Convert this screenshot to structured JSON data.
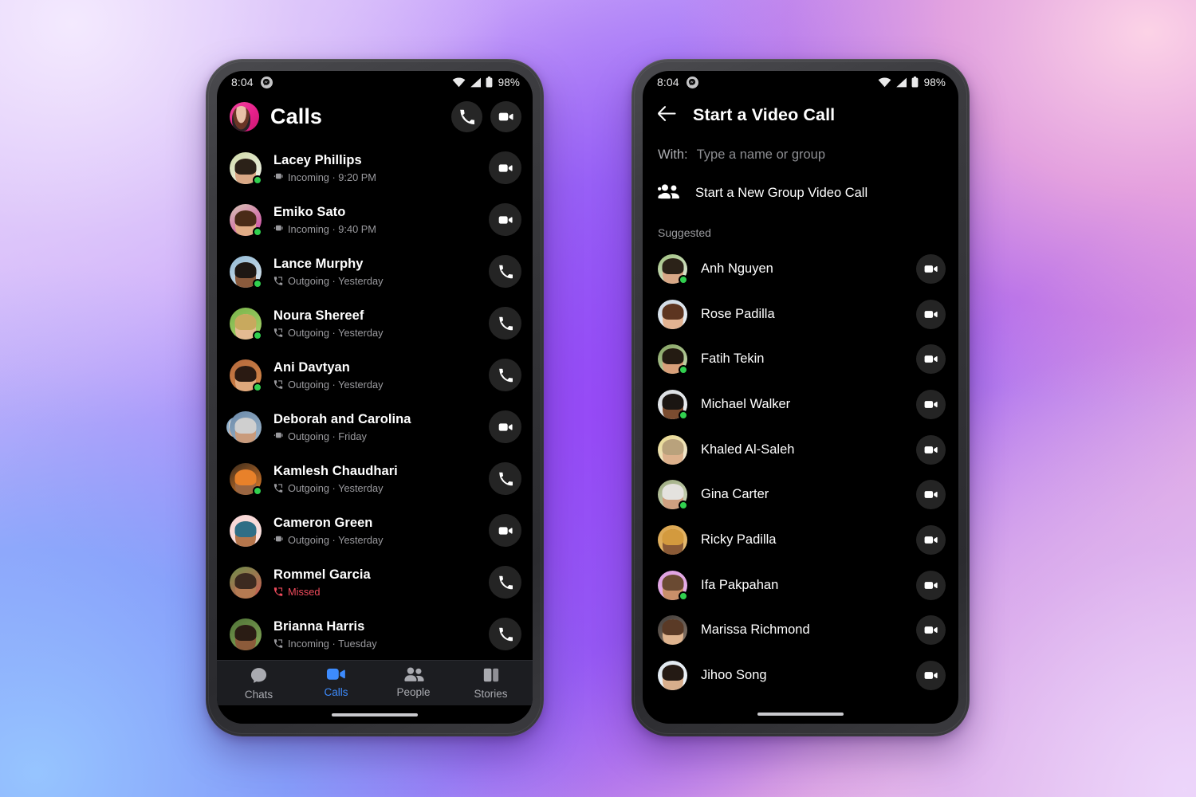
{
  "background": {
    "accent_purple": "#9648f6",
    "accent_pink": "#f68ccd",
    "accent_blue": "#7ab0fc"
  },
  "status_bar": {
    "time": "8:04",
    "battery": "98%",
    "messenger_icon": "messenger-icon",
    "wifi_icon": "wifi-icon",
    "signal_icon": "signal-icon",
    "battery_icon": "battery-icon"
  },
  "left_phone": {
    "header": {
      "title": "Calls",
      "avatar_name": "profile-avatar",
      "audio_call_button": "audio-call-icon",
      "video_call_button": "video-call-icon"
    },
    "calls": [
      {
        "name": "Lacey Phillips",
        "direction": "Incoming",
        "time": "9:20 PM",
        "sub": "Incoming · 9:20 PM",
        "type": "video",
        "action": "video",
        "online": true,
        "missed": false,
        "group": false,
        "c1": "#cfd9a6",
        "c2": "#f2f4ee",
        "hair": "#2b2118",
        "skin": "#d9a886"
      },
      {
        "name": "Emiko Sato",
        "direction": "Incoming",
        "time": "9:40 PM",
        "sub": "Incoming · 9:40 PM",
        "type": "video",
        "action": "video",
        "online": true,
        "missed": false,
        "group": false,
        "c1": "#d8c7b4",
        "c2": "#cf3fa5",
        "hair": "#4a2b18",
        "skin": "#e0ab85"
      },
      {
        "name": "Lance Murphy",
        "direction": "Outgoing",
        "time": "Yesterday",
        "sub": "Outgoing · Yesterday",
        "type": "audio",
        "action": "audio",
        "online": true,
        "missed": false,
        "group": false,
        "c1": "#8fb8d4",
        "c2": "#dfe8ee",
        "hair": "#1d1713",
        "skin": "#8a5a3c"
      },
      {
        "name": "Noura Shereef",
        "direction": "Outgoing",
        "time": "Yesterday",
        "sub": "Outgoing · Yesterday",
        "type": "audio",
        "action": "audio",
        "online": true,
        "missed": false,
        "group": false,
        "c1": "#79b34a",
        "c2": "#a9d46b",
        "hair": "#c8a95e",
        "skin": "#e4bb92"
      },
      {
        "name": "Ani Davtyan",
        "direction": "Outgoing",
        "time": "Yesterday",
        "sub": "Outgoing · Yesterday",
        "type": "audio",
        "action": "audio",
        "online": true,
        "missed": false,
        "group": false,
        "c1": "#b3683c",
        "c2": "#d88a4a",
        "hair": "#2a1a12",
        "skin": "#dfa87c"
      },
      {
        "name": "Deborah and Carolina",
        "direction": "Outgoing",
        "time": "Friday",
        "sub": "Outgoing · Friday",
        "type": "video",
        "action": "video",
        "online": false,
        "missed": false,
        "group": true,
        "c1": "#6a88a8",
        "c2": "#9fb8cc",
        "hair": "#cfcfcf",
        "skin": "#c99b7c"
      },
      {
        "name": "Kamlesh Chaudhari",
        "direction": "Outgoing",
        "time": "Yesterday",
        "sub": "Outgoing · Yesterday",
        "type": "audio",
        "action": "audio",
        "online": true,
        "missed": false,
        "group": false,
        "c1": "#3a2a1c",
        "c2": "#e8812a",
        "hair": "#e8812a",
        "skin": "#9a6642"
      },
      {
        "name": "Cameron Green",
        "direction": "Outgoing",
        "time": "Yesterday",
        "sub": "Outgoing · Yesterday",
        "type": "video",
        "action": "video",
        "online": false,
        "missed": false,
        "group": false,
        "c1": "#f7d4d4",
        "c2": "#fbe4e1",
        "hair": "#2f6e86",
        "skin": "#b5764c"
      },
      {
        "name": "Rommel Garcia",
        "direction": "Missed",
        "time": "",
        "sub": "Missed",
        "type": "audio",
        "action": "audio",
        "online": false,
        "missed": true,
        "group": false,
        "c1": "#6e8e4a",
        "c2": "#cf5b55",
        "hair": "#3c2a20",
        "skin": "#b47a52"
      },
      {
        "name": "Brianna Harris",
        "direction": "Incoming",
        "time": "Tuesday",
        "sub": "Incoming · Tuesday",
        "type": "audio",
        "action": "audio",
        "online": false,
        "missed": false,
        "group": false,
        "c1": "#4f7236",
        "c2": "#86a95a",
        "hair": "#2a1c14",
        "skin": "#8c5b3a"
      }
    ],
    "bottom_nav": [
      {
        "label": "Chats",
        "icon": "chats-icon",
        "active": false
      },
      {
        "label": "Calls",
        "icon": "calls-icon",
        "active": true
      },
      {
        "label": "People",
        "icon": "people-icon",
        "active": false
      },
      {
        "label": "Stories",
        "icon": "stories-icon",
        "active": false
      }
    ]
  },
  "right_phone": {
    "header": {
      "back_icon": "back-arrow-icon",
      "title": "Start a Video Call"
    },
    "with_row": {
      "label": "With:",
      "placeholder": "Type a name or group",
      "value": ""
    },
    "group_call": {
      "icon": "group-people-icon",
      "label": "Start a New Group Video Call"
    },
    "suggested_label": "Suggested",
    "suggested": [
      {
        "name": "Anh Nguyen",
        "online": true,
        "c1": "#9dbf7c",
        "c2": "#e7eee2",
        "hair": "#2b2218",
        "skin": "#d8a887"
      },
      {
        "name": "Rose Padilla",
        "online": false,
        "c1": "#cdd8e4",
        "c2": "#eef2f6",
        "hair": "#5d3520",
        "skin": "#e2b392"
      },
      {
        "name": "Fatih Tekin",
        "online": true,
        "c1": "#7f9e5c",
        "c2": "#cfe0b8",
        "hair": "#241b12",
        "skin": "#d8a07a"
      },
      {
        "name": "Michael Walker",
        "online": true,
        "c1": "#d9dde1",
        "c2": "#eef1f4",
        "hair": "#1a1512",
        "skin": "#7a4c30"
      },
      {
        "name": "Khaled Al-Saleh",
        "online": false,
        "c1": "#e8d88a",
        "c2": "#f2eadf",
        "hair": "#b9a27c",
        "skin": "#dcb18c"
      },
      {
        "name": "Gina Carter",
        "online": true,
        "c1": "#9aa87c",
        "c2": "#d6ddc4",
        "hair": "#e4e2de",
        "skin": "#cfa080"
      },
      {
        "name": "Ricky Padilla",
        "online": false,
        "c1": "#d9a24a",
        "c2": "#e8c07a",
        "hair": "#d39a3e",
        "skin": "#8a5a36"
      },
      {
        "name": "Ifa Pakpahan",
        "online": true,
        "c1": "#dd9fe0",
        "c2": "#e8b3e9",
        "hair": "#6a4a32",
        "skin": "#c98f6a"
      },
      {
        "name": "Marissa Richmond",
        "online": false,
        "c1": "#3d3a38",
        "c2": "#8d7a6c",
        "hair": "#5a3a26",
        "skin": "#dfb48f"
      },
      {
        "name": "Jihoo Song",
        "online": false,
        "c1": "#dde6ee",
        "c2": "#f2f6fa",
        "hair": "#241a14",
        "skin": "#d8ae8c"
      }
    ]
  }
}
